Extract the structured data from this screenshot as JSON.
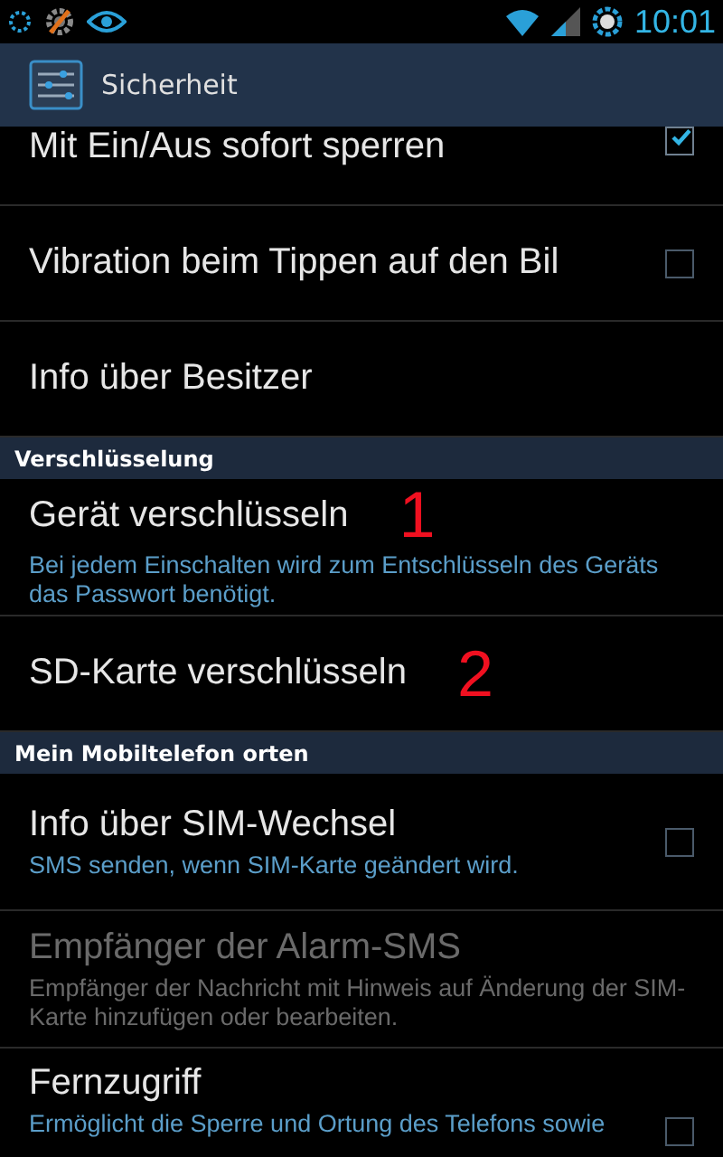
{
  "status_bar": {
    "time": "10:01"
  },
  "title_bar": {
    "title": "Sicherheit"
  },
  "items": [
    {
      "kind": "setting",
      "title": "Mit Ein/Aus sofort sperren",
      "checked": true,
      "disabled": false
    },
    {
      "kind": "setting",
      "title": "Vibration beim Tippen auf den Bil",
      "checked": false,
      "disabled": false
    },
    {
      "kind": "setting",
      "title": "Info über Besitzer",
      "disabled": false
    },
    {
      "kind": "header",
      "title": "Verschlüsselung"
    },
    {
      "kind": "setting",
      "title": "Gerät verschlüsseln",
      "summary": "Bei jedem Einschalten wird zum Entschlüsseln des Geräts das Passwort benötigt.",
      "annotation": "1",
      "disabled": false
    },
    {
      "kind": "setting",
      "title": "SD-Karte verschlüsseln",
      "annotation": "2",
      "disabled": false
    },
    {
      "kind": "header",
      "title": "Mein Mobiltelefon orten"
    },
    {
      "kind": "setting",
      "title": "Info über SIM-Wechsel",
      "summary": "SMS senden, wenn SIM-Karte geändert wird.",
      "checked": false,
      "disabled": false
    },
    {
      "kind": "setting",
      "title": "Empfänger der Alarm-SMS",
      "summary": "Empfänger der Nachricht mit Hinweis auf Änderung der SIM-Karte hinzufügen oder bearbeiten.",
      "disabled": true
    },
    {
      "kind": "setting",
      "title": "Fernzugriff",
      "summary": "Ermöglicht die Sperre und Ortung des Telefons sowie",
      "checked": false,
      "disabled": false
    }
  ]
}
